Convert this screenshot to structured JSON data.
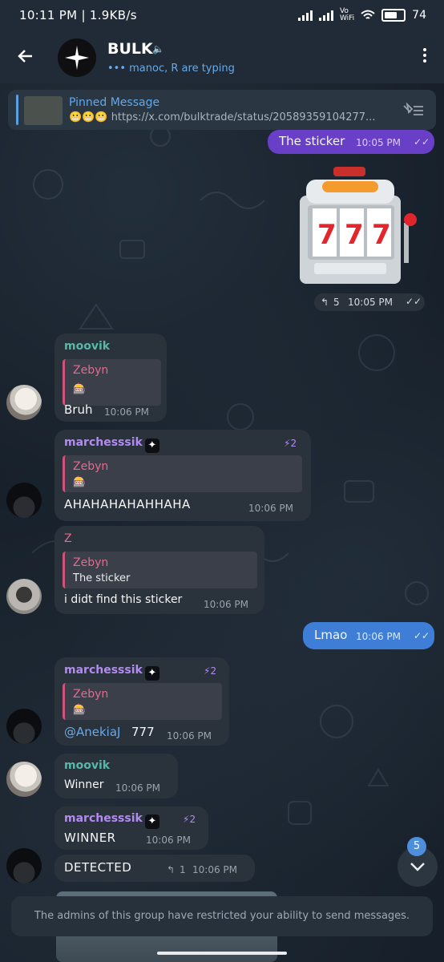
{
  "status_bar": {
    "time_speed": "10:11 PM | 1.9KB/s",
    "battery": "74"
  },
  "header": {
    "title": "BULK",
    "subtitle": "manoc, R are typing"
  },
  "pinned": {
    "label": "Pinned Message",
    "text": "😬😬😬   https://x.com/bulktrade/status/20589359104277..."
  },
  "messages": {
    "m1": {
      "text": "The sticker",
      "time": "10:05 PM"
    },
    "m2": {
      "replies": "5",
      "time": "10:05 PM"
    },
    "m3": {
      "author": "moovik",
      "reply_name": "Zebyn",
      "reply_text": "🎰",
      "text": "Bruh",
      "time": "10:06 PM"
    },
    "m4": {
      "author": "marchesssik",
      "boost": "2",
      "reply_name": "Zebyn",
      "reply_text": "🎰",
      "text": "AHAHAHAHAHHAHA",
      "time": "10:06 PM"
    },
    "m5": {
      "author": "Z",
      "reply_name": "Zebyn",
      "reply_text": "The sticker",
      "text": "i didt find this sticker",
      "time": "10:06 PM"
    },
    "m6": {
      "text": "Lmao",
      "time": "10:06 PM"
    },
    "m7": {
      "author": "marchesssik",
      "boost": "2",
      "reply_name": "Zebyn",
      "reply_text": "🎰",
      "mention": "@AnekiaJ",
      "text": "777",
      "time": "10:06 PM"
    },
    "m8": {
      "author": "moovik",
      "text": "Winner",
      "time": "10:06 PM"
    },
    "m9": {
      "author": "marchesssik",
      "boost": "2",
      "text": "WINNER",
      "time": "10:06 PM"
    },
    "m10": {
      "text": "DETECTED",
      "replies": "1",
      "time": "10:06 PM"
    }
  },
  "unread_count": "5",
  "restricted_notice": "The admins of this group have restricted your ability to send messages.",
  "colors": {
    "accent": "#5eaaf0",
    "outgoing": "#6a3fc8",
    "outgoing_blue": "#3f7ed6",
    "reply_bar": "#d1527a",
    "author_moovik": "#58b8a8",
    "author_marchesssik": "#b28bf2"
  }
}
